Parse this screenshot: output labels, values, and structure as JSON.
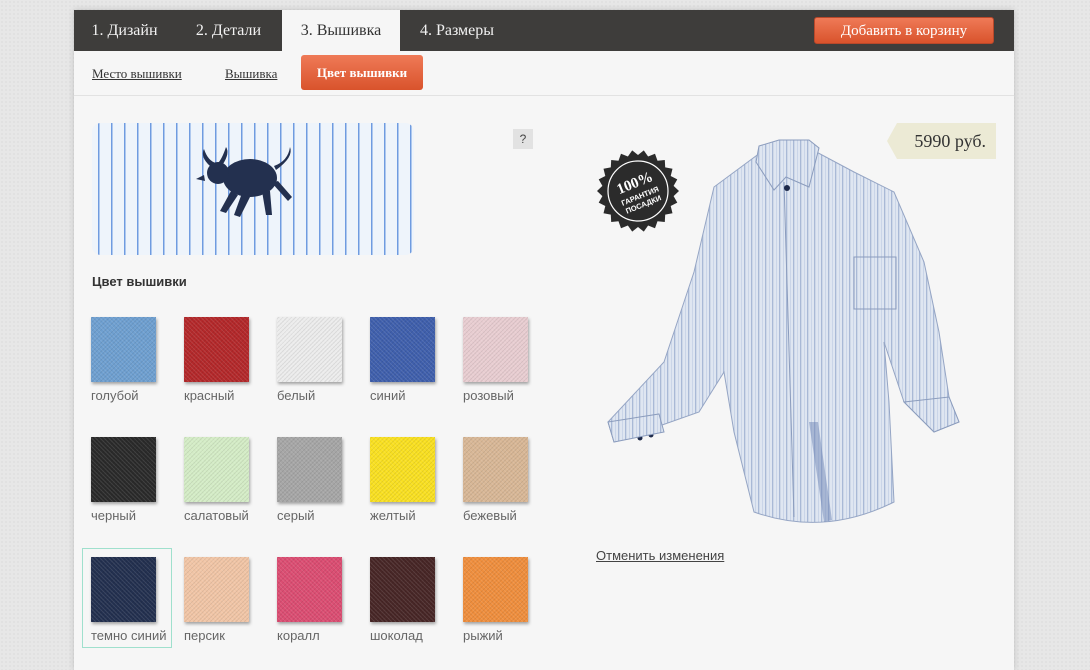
{
  "tabs": [
    {
      "label": "1. Дизайн",
      "active": false
    },
    {
      "label": "2. Детали",
      "active": false
    },
    {
      "label": "3. Вышивка",
      "active": true
    },
    {
      "label": "4. Размеры",
      "active": false
    }
  ],
  "cart_button": "Добавить в корзину",
  "subnav": {
    "place": "Место вышивки",
    "embroidery": "Вышивка",
    "color": "Цвет вышивки"
  },
  "help": "?",
  "section_title": "Цвет вышивки",
  "swatches": [
    {
      "label": "голубой",
      "color": "#6e9fd0"
    },
    {
      "label": "красный",
      "color": "#b3282a"
    },
    {
      "label": "белый",
      "color": "#ececec"
    },
    {
      "label": "синий",
      "color": "#3f5fac"
    },
    {
      "label": "розовый",
      "color": "#e8cdd1"
    },
    {
      "label": "черный",
      "color": "#2a2a2a"
    },
    {
      "label": "салатовый",
      "color": "#d4ecc6"
    },
    {
      "label": "серый",
      "color": "#a6a6a6"
    },
    {
      "label": "желтый",
      "color": "#f9e021"
    },
    {
      "label": "бежевый",
      "color": "#d8b796"
    },
    {
      "label": "темно синий",
      "color": "#23304f",
      "selected": true
    },
    {
      "label": "персик",
      "color": "#f1c5a6"
    },
    {
      "label": "коралл",
      "color": "#db4d72"
    },
    {
      "label": "шоколад",
      "color": "#472626"
    },
    {
      "label": "рыжий",
      "color": "#ef8e3d"
    }
  ],
  "price": "5990 руб.",
  "badge": {
    "line1": "100%",
    "line2": "ГАРАНТИЯ",
    "line3": "ПОСАДКИ"
  },
  "cancel_link": "Отменить изменения",
  "colors": {
    "accent": "#e06a46",
    "topbar": "#3e3d3b",
    "selected_border": "#9fe0cd",
    "preview_motif": "#23304f"
  }
}
